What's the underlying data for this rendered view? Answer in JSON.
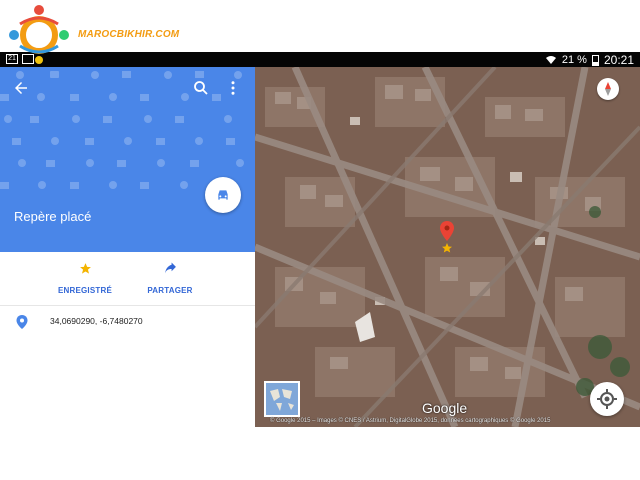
{
  "watermark": {
    "text": "MAROCBIKHIR.COM"
  },
  "status_bar": {
    "notification_icons": [
      "sim-icon",
      "image-icon"
    ],
    "battery_percent": "21 %",
    "time": "20:21",
    "wifi": "wifi-icon"
  },
  "place": {
    "title": "Repère placé",
    "back_icon": "arrow-back-icon",
    "search_icon": "search-icon",
    "menu_icon": "more-vert-icon",
    "fab_icon": "car-icon"
  },
  "actions": [
    {
      "label": "ENREGISTRÉ",
      "icon": "star-icon"
    },
    {
      "label": "PARTAGER",
      "icon": "share-icon"
    }
  ],
  "location": {
    "icon": "pin-icon",
    "coordinates": "34,0690290, -6,7480270"
  },
  "map": {
    "logo": "Google",
    "attribution": "© Google 2015 – Images © CNES / Astrium, DigitalGlobe 2015, données cartographiques © Google 2015",
    "marker_icon": "red-pin-icon",
    "compass_icon": "compass-icon",
    "locate_icon": "my-location-icon",
    "minimap_icon": "world-minimap"
  },
  "colors": {
    "header_blue": "#4a86e8",
    "accent_blue": "#3367d6",
    "star": "#f4b400",
    "marker_red": "#ea4335"
  }
}
